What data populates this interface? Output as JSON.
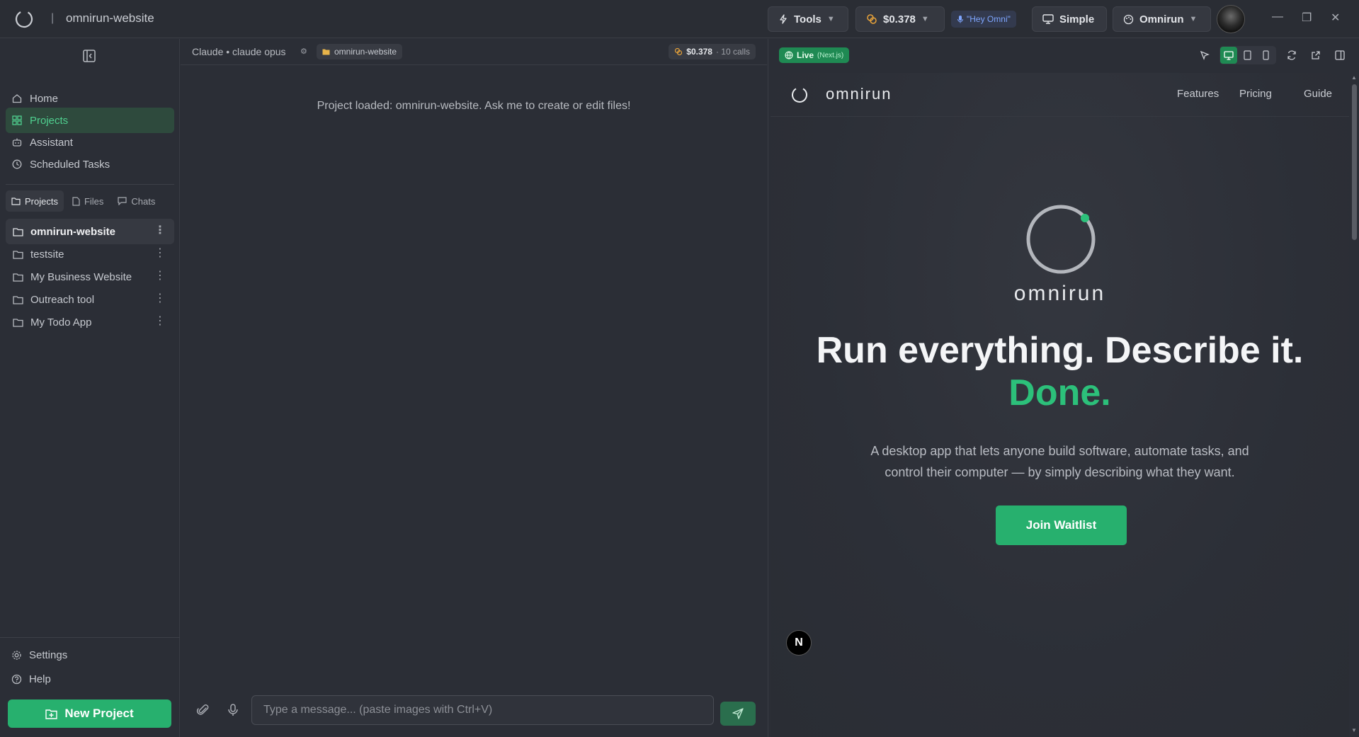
{
  "titlebar": {
    "title": "omnirun-website",
    "separator": "|",
    "tools_label": "Tools",
    "cost_label": "$0.378",
    "hey_omni_label": "\"Hey Omni\"",
    "mode_label": "Simple",
    "account_label": "Omnirun"
  },
  "sidebar": {
    "nav": [
      {
        "label": "Home",
        "icon": "home-icon"
      },
      {
        "label": "Projects",
        "icon": "grid-icon",
        "active": true
      },
      {
        "label": "Assistant",
        "icon": "bot-icon"
      },
      {
        "label": "Scheduled Tasks",
        "icon": "clock-icon"
      }
    ],
    "tabs": [
      {
        "label": "Projects",
        "active": true
      },
      {
        "label": "Files"
      },
      {
        "label": "Chats"
      }
    ],
    "projects": [
      {
        "label": "omnirun-website",
        "active": true
      },
      {
        "label": "testsite"
      },
      {
        "label": "My Business Website"
      },
      {
        "label": "Outreach tool"
      },
      {
        "label": "My Todo App"
      }
    ],
    "settings_label": "Settings",
    "help_label": "Help",
    "new_project_label": "New Project"
  },
  "chat": {
    "model_label": "Claude • claude opus",
    "project_chip": "omnirun-website",
    "cost": "$0.378",
    "calls": "· 10 calls",
    "system_message": "Project loaded: omnirun-website. Ask me to create or edit files!",
    "input_placeholder": "Type a message... (paste images with Ctrl+V)"
  },
  "preview": {
    "live_label": "Live",
    "framework_label": "(Next.js)",
    "site": {
      "brand": "omnirun",
      "nav_links": [
        "Features",
        "Pricing",
        "Guide"
      ],
      "hero_brand": "omnirun",
      "headline": "Run everything. Describe it.",
      "headline_accent": "Done.",
      "description": "A desktop app that lets anyone build software, automate tasks, and control their computer — by simply describing what they want.",
      "cta_label": "Join Waitlist",
      "next_badge": "N"
    }
  },
  "colors": {
    "accent": "#27b06e",
    "accent_text": "#2cc07a",
    "background": "#2b2e36",
    "active_nav_bg": "#2e4a3d"
  }
}
